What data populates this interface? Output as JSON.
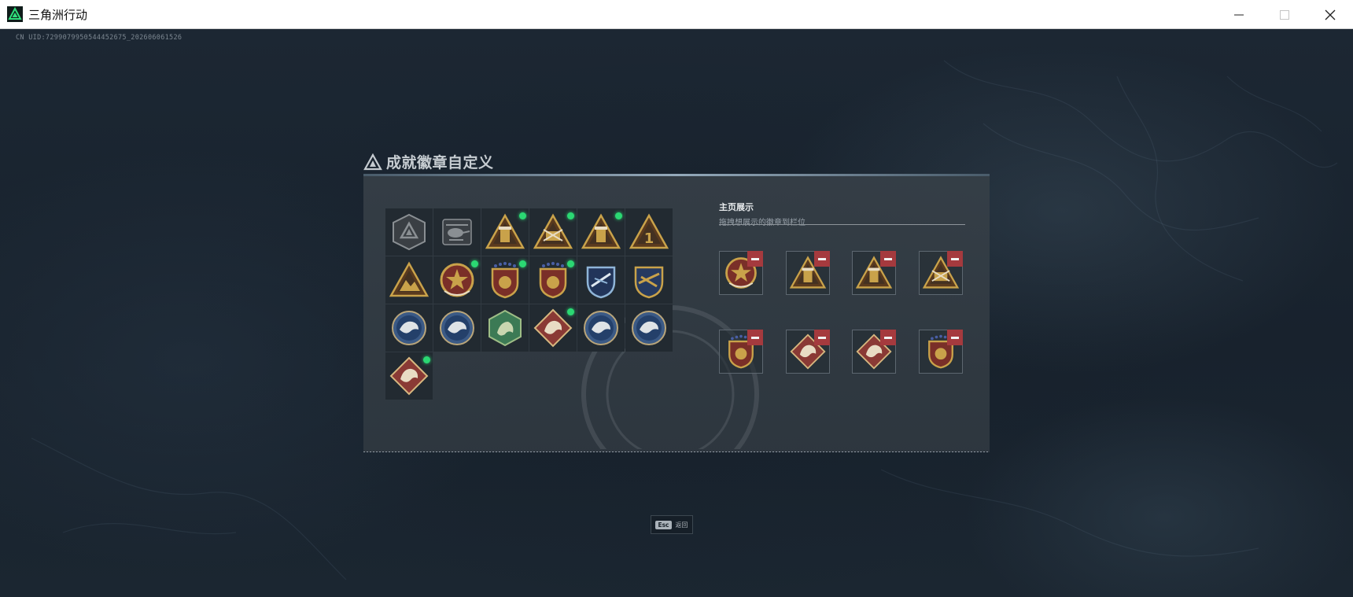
{
  "window": {
    "title": "三角洲行动"
  },
  "game": {
    "uid_text": "CN UID:7299079950544452675_202606061526",
    "panel_title": "成就徽章自定义",
    "display_section": {
      "title": "主页展示",
      "subtitle": "拖拽想展示的徽章到栏位"
    },
    "back": {
      "key": "Esc",
      "label": "返回"
    }
  },
  "badges": [
    {
      "type": "delta-hex",
      "color": "#8a8f93",
      "new": false
    },
    {
      "type": "helicopter",
      "color": "#8a8f93",
      "new": false
    },
    {
      "type": "tower-tri",
      "color": "#c9a24a",
      "new": true
    },
    {
      "type": "guns-tri",
      "color": "#c9a24a",
      "new": true
    },
    {
      "type": "tower-tri",
      "color": "#c9a24a",
      "new": true
    },
    {
      "type": "one-tri",
      "color": "#c9a24a",
      "new": false
    },
    {
      "type": "mountain-tri",
      "color": "#c9a24a",
      "new": false
    },
    {
      "type": "star-medal",
      "color": "#c9a24a",
      "new": true
    },
    {
      "type": "shield-medal",
      "color": "#c9a24a",
      "new": true
    },
    {
      "type": "shield-medal",
      "color": "#c9a24a",
      "new": true
    },
    {
      "type": "blue-shield",
      "color": "#5d8fc0",
      "new": false
    },
    {
      "type": "gold-shield",
      "color": "#c9a24a",
      "new": false
    },
    {
      "type": "eagle-circle",
      "color": "#3b5a86",
      "new": false
    },
    {
      "type": "eagle-circle",
      "color": "#3b5a86",
      "new": false
    },
    {
      "type": "dragon-hex",
      "color": "#3c7a55",
      "new": false
    },
    {
      "type": "beast-diamond",
      "color": "#8a3a35",
      "new": true
    },
    {
      "type": "wolf-circle",
      "color": "#3b5a86",
      "new": false
    },
    {
      "type": "wolf-circle",
      "color": "#3b5a86",
      "new": false
    },
    {
      "type": "eagle-diamond",
      "color": "#8a3a35",
      "new": true
    }
  ],
  "displayed_badges": [
    {
      "type": "star-medal",
      "color": "#c9a24a"
    },
    {
      "type": "tower-tri",
      "color": "#c9a24a"
    },
    {
      "type": "tower-tri",
      "color": "#c9a24a"
    },
    {
      "type": "guns-tri",
      "color": "#c9a24a"
    },
    {
      "type": "shield-medal",
      "color": "#c9a24a"
    },
    {
      "type": "eagle-diamond",
      "color": "#8a3a35"
    },
    {
      "type": "beast-diamond",
      "color": "#8a3a35"
    },
    {
      "type": "shield-medal",
      "color": "#c9a24a"
    }
  ],
  "colors": {
    "accent_green": "#2bd873",
    "remove_red": "#a53a3e",
    "gold": "#c9a24a"
  }
}
